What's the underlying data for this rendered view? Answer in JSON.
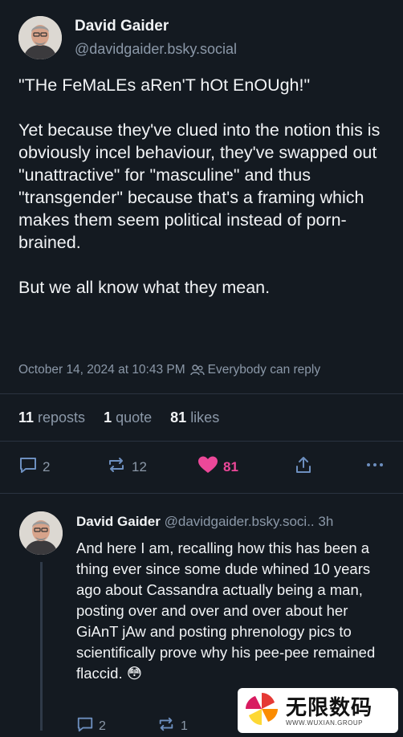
{
  "post": {
    "author": {
      "display_name": "David Gaider",
      "handle": "@davidgaider.bsky.social"
    },
    "paragraphs": [
      "\"THe FeMaLEs aRen'T hOt EnOUgh!\"",
      "Yet because they've clued into the notion this is obviously incel behaviour, they've swapped out \"unattractive\" for \"masculine\" and thus \"transgender\" because that's a framing which makes them seem political instead of porn-brained.",
      "But we all know what they mean."
    ],
    "timestamp": "October 14, 2024 at 10:43 PM",
    "reply_permission": "Everybody can reply",
    "stats": {
      "reposts_count": "11",
      "reposts_label": "reposts",
      "quotes_count": "1",
      "quotes_label": "quote",
      "likes_count": "81",
      "likes_label": "likes"
    },
    "actions": {
      "reply_count": "2",
      "repost_count": "12",
      "like_count": "81"
    }
  },
  "reply": {
    "author": {
      "display_name": "David Gaider",
      "handle": "@davidgaider.bsky.soci..",
      "age": "3h"
    },
    "text": "And here I am, recalling how this has been a thing ever since some dude whined 10 years ago about Cassandra actually being a man, posting over and over and over about her GiAnT jAw and posting phrenology pics to scientifically prove why his pee-pee remained flaccid. 😳",
    "actions": {
      "reply_count": "2",
      "repost_count": "1"
    }
  },
  "watermark": {
    "main_text": "无限数码",
    "sub_text": "WWW.WUXIAN.GROUP"
  },
  "colors": {
    "background": "#141a21",
    "text": "#f1f3f5",
    "muted": "#8b98a8",
    "like_accent": "#ec4899",
    "icon_blue": "#6d8fbf"
  },
  "icons": {
    "reply": "speech-bubble-icon",
    "repost": "repost-arrows-icon",
    "like": "heart-icon",
    "share": "share-upload-icon",
    "more": "more-dots-icon",
    "audience": "people-icon"
  }
}
